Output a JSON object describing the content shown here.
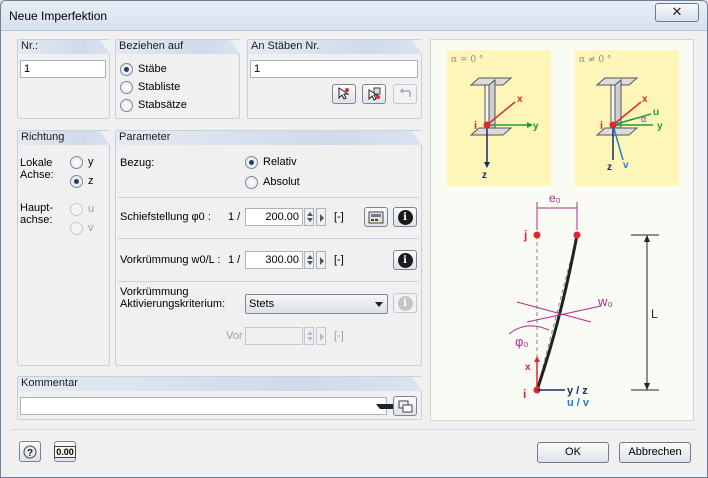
{
  "window": {
    "title": "Neue Imperfektion",
    "close_glyph": "✕"
  },
  "nr": {
    "header": "Nr.:",
    "value": "1"
  },
  "beziehen": {
    "header": "Beziehen auf",
    "options": [
      "Stäbe",
      "Stabliste",
      "Stabsätze"
    ],
    "selected": "Stäbe"
  },
  "staebe": {
    "header": "An Stäben Nr.",
    "value": "1"
  },
  "richtung": {
    "header": "Richtung",
    "local_label_1": "Lokale",
    "local_label_2": "Achse:",
    "local_options": [
      "y",
      "z"
    ],
    "local_selected": "z",
    "main_label_1": "Haupt-",
    "main_label_2": "achse:",
    "main_options": [
      "u",
      "v"
    ]
  },
  "parameter": {
    "header": "Parameter",
    "bezug_label": "Bezug:",
    "bezug_options": [
      "Relativ",
      "Absolut"
    ],
    "bezug_selected": "Relativ",
    "schief_label": "Schiefstellung φ0 :",
    "schief_prefix": "1 /",
    "schief_value": "200.00",
    "schief_unit": "[-]",
    "vork_label": "Vorkrümmung w0/L :",
    "vork_prefix": "1 /",
    "vork_value": "300.00",
    "vork_unit": "[-]",
    "akt_label_1": "Vorkrümmung",
    "akt_label_2": "Aktivierungskriterium:",
    "akt_value": "Stets",
    "vor_label": "Vor",
    "vor_unit": "[-]"
  },
  "kommentar": {
    "header": "Kommentar",
    "value": ""
  },
  "buttons": {
    "ok": "OK",
    "cancel": "Abbrechen",
    "units_label": "0.00"
  },
  "illustration": {
    "alpha_zero": "α = 0 °",
    "alpha_nonzero": "α ≠ 0 °",
    "i": "i",
    "j": "j",
    "x": "x",
    "y": "y",
    "z": "z",
    "u": "u",
    "v": "v",
    "alpha": "α",
    "e0": "e₀",
    "w0": "w₀",
    "phi0": "φ₀",
    "L": "L",
    "yz": "y / z",
    "uv": "u / v",
    "slash": "/"
  },
  "colors": {
    "accent": "#d8e3f1",
    "panel_yellow": "#fdf6b8",
    "red": "#e3262b",
    "green": "#1a9d3a",
    "blue": "#1f7fd0",
    "purple": "#b02c8e"
  }
}
